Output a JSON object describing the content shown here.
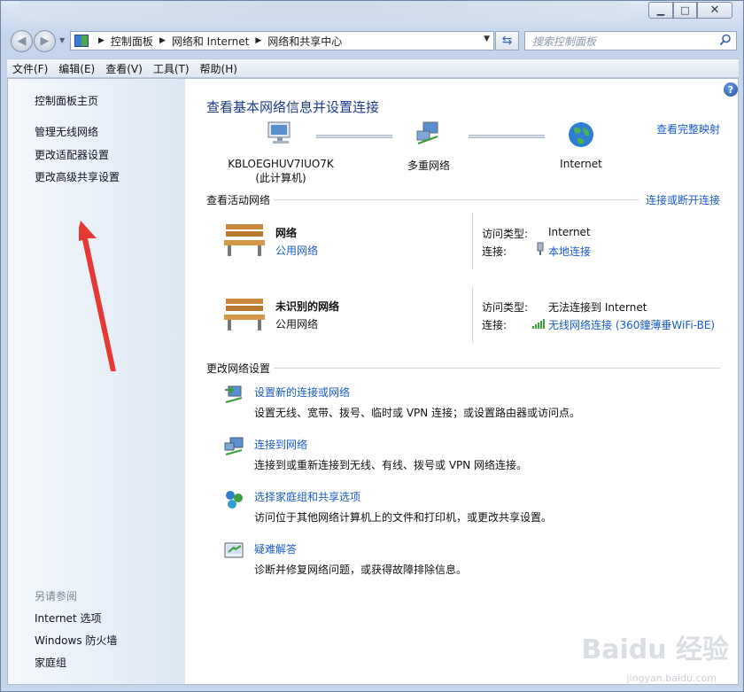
{
  "window": {
    "min_icon": "minimize-icon",
    "max_icon": "maximize-icon",
    "close_icon": "close-icon"
  },
  "address": {
    "crumbs": [
      "控制面板",
      "网络和 Internet",
      "网络和共享中心"
    ],
    "search_placeholder": "搜索控制面板"
  },
  "menu": [
    "文件(F)",
    "编辑(E)",
    "查看(V)",
    "工具(T)",
    "帮助(H)"
  ],
  "sidebar": {
    "home": "控制面板主页",
    "links": [
      "管理无线网络",
      "更改适配器设置",
      "更改高级共享设置"
    ],
    "see_also_title": "另请参阅",
    "see_also": [
      "Internet 选项",
      "Windows 防火墙",
      "家庭组"
    ]
  },
  "main": {
    "title": "查看基本网络信息并设置连接",
    "view_full_map": "查看完整映射",
    "nodes": [
      {
        "line1": "KBLOEGHUV7IUO7K",
        "line2": "(此计算机)"
      },
      {
        "line1": "多重网络",
        "line2": ""
      },
      {
        "line1": "Internet",
        "line2": ""
      }
    ],
    "active_title": "查看活动网络",
    "connect_disconnect": "连接或断开连接",
    "networks": [
      {
        "name": "网络",
        "type": "公用网络",
        "type_is_link": true,
        "access_label": "访问类型:",
        "access": "Internet",
        "conn_label": "连接:",
        "conn": "本地连接"
      },
      {
        "name": "未识别的网络",
        "type": "公用网络",
        "type_is_link": false,
        "access_label": "访问类型:",
        "access": "无法连接到 Internet",
        "conn_label": "连接:",
        "conn": "无线网络连接 (360鐘薄垂WiFi-BE)"
      }
    ],
    "change_title": "更改网络设置",
    "tasks": [
      {
        "link": "设置新的连接或网络",
        "desc": "设置无线、宽带、拨号、临时或 VPN 连接；或设置路由器或访问点。"
      },
      {
        "link": "连接到网络",
        "desc": "连接到或重新连接到无线、有线、拨号或 VPN 网络连接。"
      },
      {
        "link": "选择家庭组和共享选项",
        "desc": "访问位于其他网络计算机上的文件和打印机，或更改共享设置。"
      },
      {
        "link": "疑难解答",
        "desc": "诊断并修复网络问题，或获得故障排除信息。"
      }
    ]
  },
  "watermark": {
    "text": "Baidu 经验",
    "sub": "jingyan.baidu.com"
  }
}
